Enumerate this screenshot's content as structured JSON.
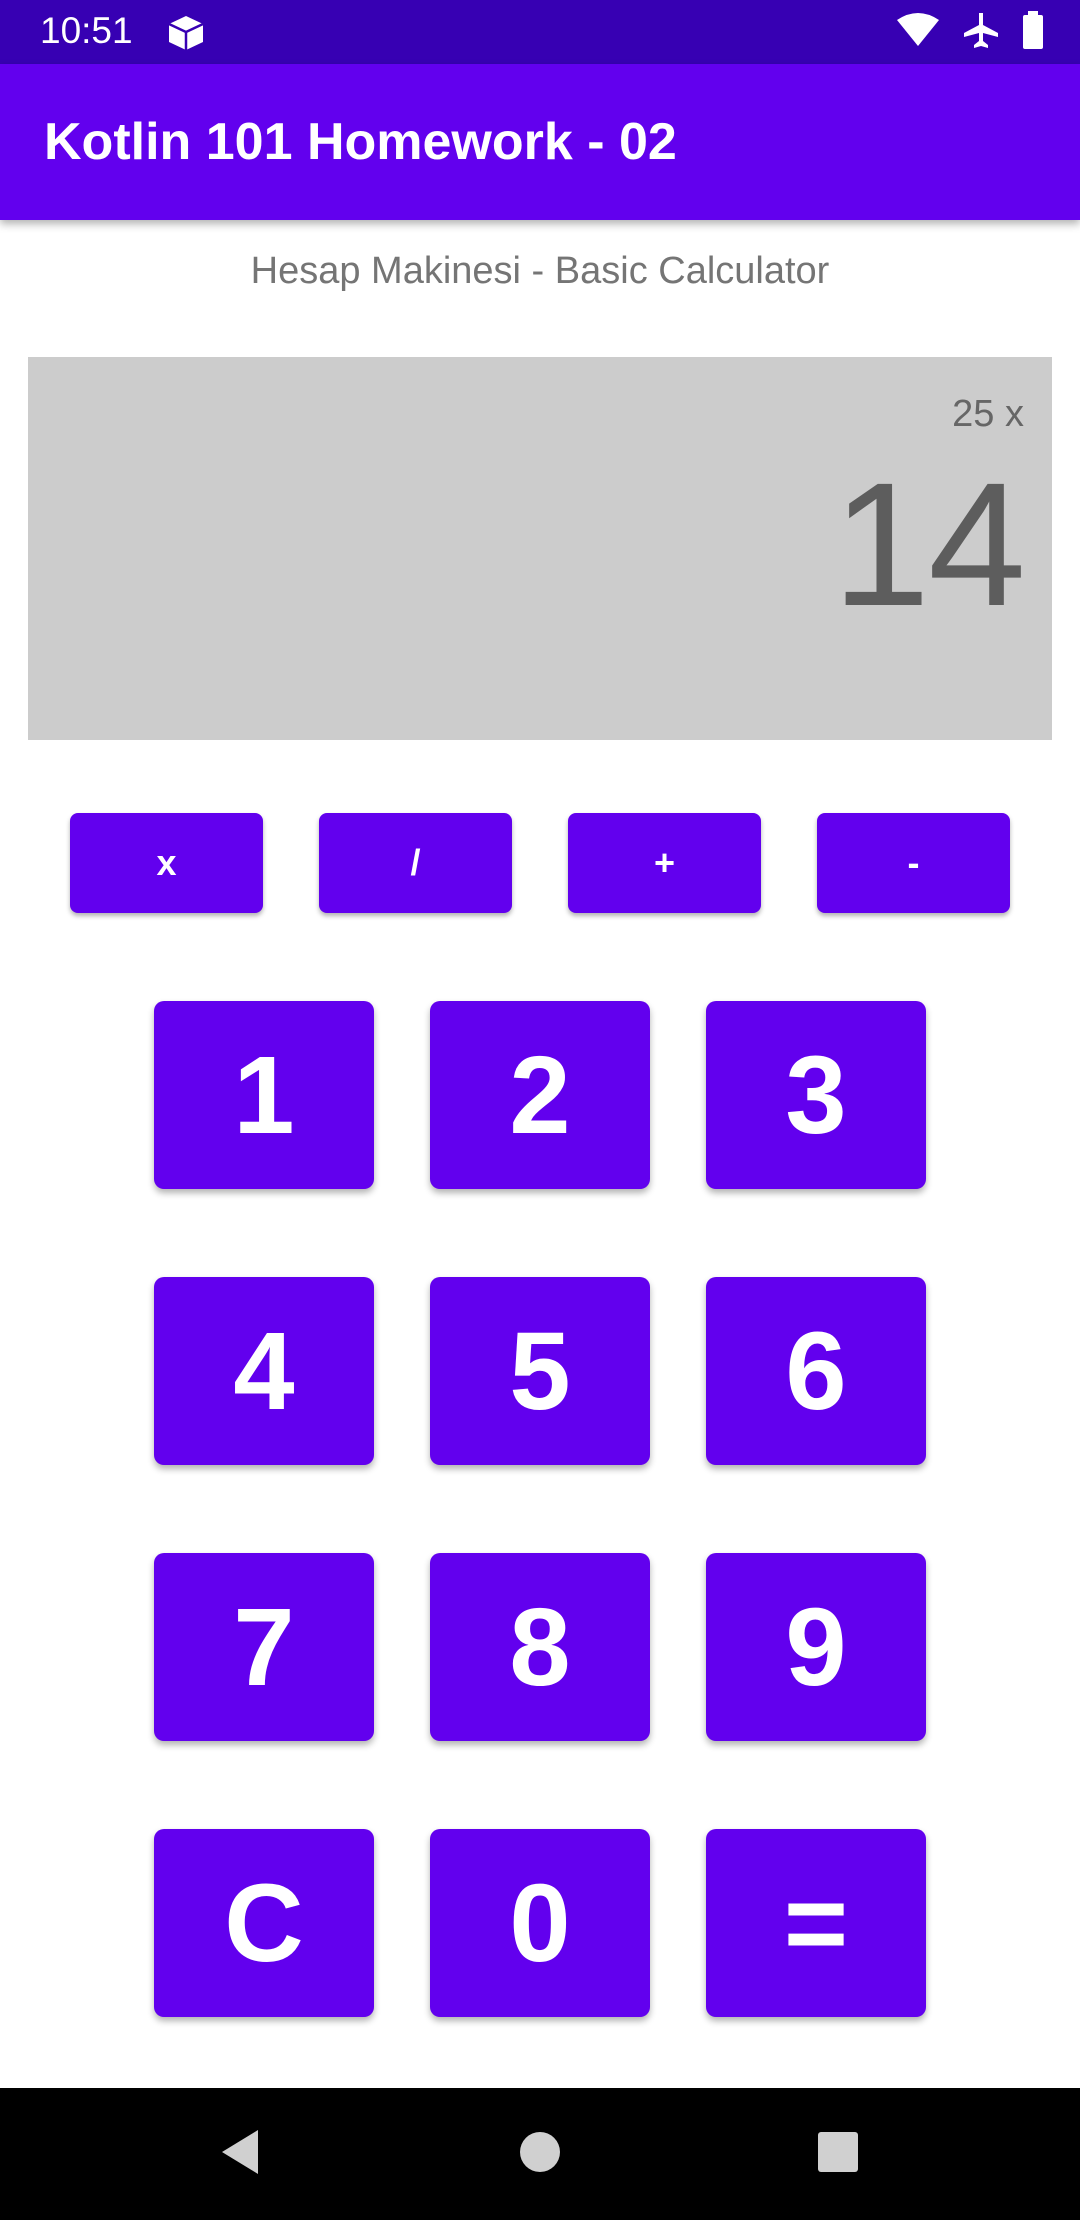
{
  "status_bar": {
    "time": "10:51",
    "icons": [
      "box-notification-icon",
      "wifi-icon",
      "airplane-mode-icon",
      "battery-icon"
    ]
  },
  "app_bar": {
    "title": "Kotlin 101 Homework - 02"
  },
  "subtitle": "Hesap Makinesi - Basic Calculator",
  "display": {
    "expression": "25 x",
    "result": "14"
  },
  "operators": [
    {
      "label": "x"
    },
    {
      "label": "/"
    },
    {
      "label": "+"
    },
    {
      "label": "-"
    }
  ],
  "keypad": [
    {
      "label": "1"
    },
    {
      "label": "2"
    },
    {
      "label": "3"
    },
    {
      "label": "4"
    },
    {
      "label": "5"
    },
    {
      "label": "6"
    },
    {
      "label": "7"
    },
    {
      "label": "8"
    },
    {
      "label": "9"
    },
    {
      "label": "C"
    },
    {
      "label": "0"
    },
    {
      "label": "="
    }
  ],
  "nav_bar": {
    "icons": [
      "back-icon",
      "home-icon",
      "recents-icon"
    ]
  },
  "colors": {
    "status_bar": "#3700b3",
    "primary": "#6200ee",
    "display_bg": "#cccccc",
    "display_text": "#5d5d5d"
  }
}
